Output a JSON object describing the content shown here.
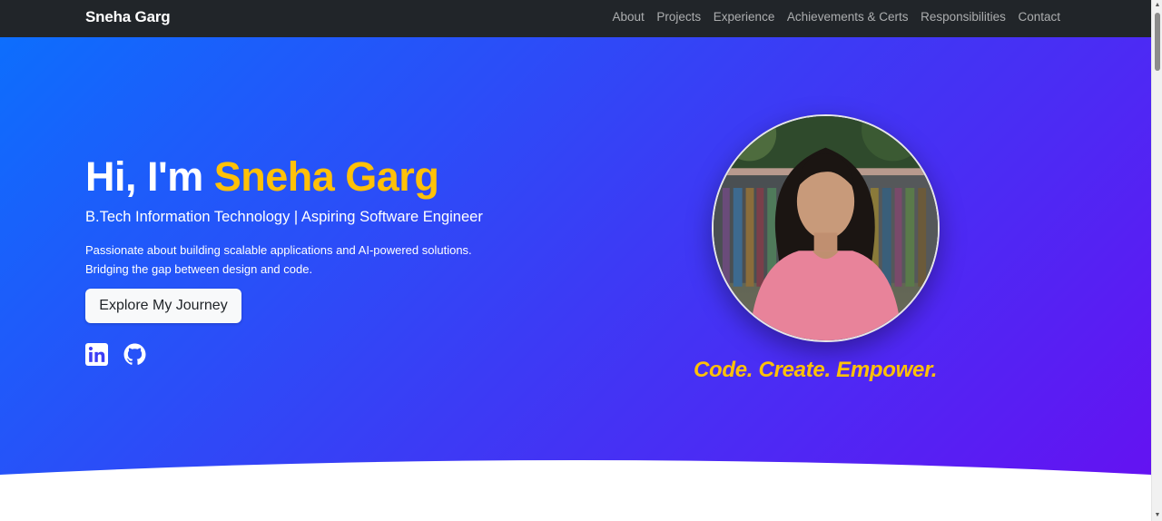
{
  "navbar": {
    "brand": "Sneha Garg",
    "links": [
      "About",
      "Projects",
      "Experience",
      "Achievements & Certs",
      "Responsibilities",
      "Contact"
    ]
  },
  "hero": {
    "greeting": "Hi, I'm ",
    "name": "Sneha Garg",
    "subtitle": "B.Tech Information Technology | Aspiring Software Engineer",
    "description_line1": "Passionate about building scalable applications and AI-powered solutions.",
    "description_line2": "Bridging the gap between design and code.",
    "cta_label": "Explore My Journey",
    "social_icons": [
      "linkedin-icon",
      "github-icon"
    ],
    "tagline": "Code. Create. Empower."
  },
  "colors": {
    "navbar_bg": "#212529",
    "accent": "#ffc107",
    "gradient_start": "#0d6efd",
    "gradient_end": "#6610f2"
  }
}
